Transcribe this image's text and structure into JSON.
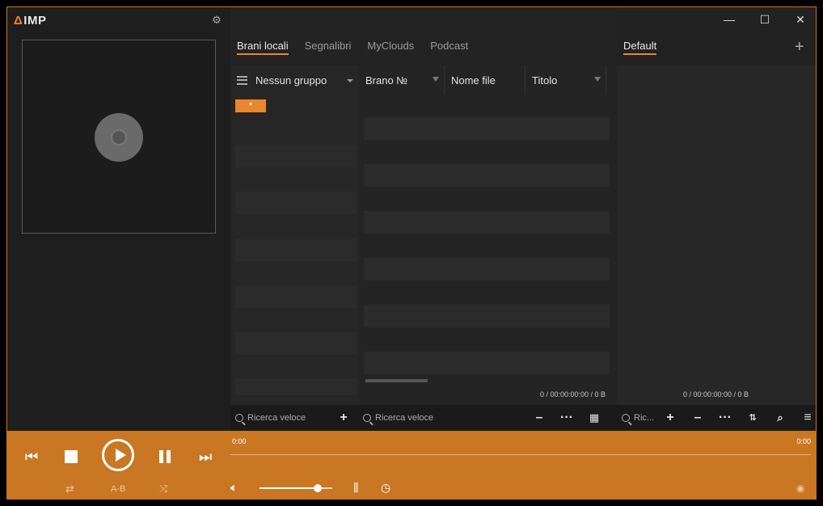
{
  "app": {
    "logo": "IMP",
    "logo_mark": "Δ",
    "settings_icon": "gear-icon"
  },
  "window": {
    "minimize": "—",
    "maximize": "☐",
    "close": "✕"
  },
  "library": {
    "tabs": [
      {
        "label": "Brani locali",
        "active": true
      },
      {
        "label": "Segnalibri",
        "active": false
      },
      {
        "label": "MyClouds",
        "active": false
      },
      {
        "label": "Podcast",
        "active": false
      }
    ],
    "group_header": "Nessun gruppo",
    "group_item": "*",
    "columns": [
      "Brano №",
      "Nome file",
      "Titolo"
    ],
    "status": "0 / 00:00:00:00 / 0 B",
    "search_placeholder": "Ricerca veloce",
    "file_search_placeholder": "Ricerca veloce"
  },
  "playlist": {
    "tab": "Default",
    "add_label": "+",
    "status": "0 / 00:00:00:00 / 0 B",
    "search_placeholder": "Ric..."
  },
  "player": {
    "time_left": "0:00",
    "time_right": "0:00",
    "ab_label": "A-B",
    "volume_fraction": 0.8,
    "accent": "#c97722",
    "highlight": "#e8872b"
  }
}
